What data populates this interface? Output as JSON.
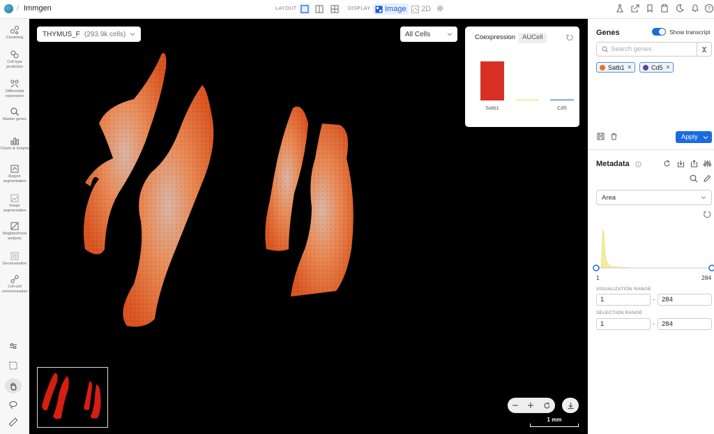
{
  "header": {
    "breadcrumb_sep": "/",
    "app_title": "Immgen",
    "layout_label": "LAYOUT",
    "display_label": "DISPLAY",
    "display_image": "Image",
    "display_2d": "2D"
  },
  "sidebar": {
    "items": [
      {
        "label": "Clustering",
        "icon": "clustering-icon"
      },
      {
        "label": "Cell type prediction",
        "icon": "cell-type-icon"
      },
      {
        "label": "Differential expression",
        "icon": "diff-expr-icon"
      },
      {
        "label": "Marker genes",
        "icon": "marker-genes-icon"
      },
      {
        "label": "Charts & Graphs",
        "icon": "charts-icon"
      },
      {
        "label": "Region segmentation",
        "icon": "region-seg-icon"
      },
      {
        "label": "Image segmentation",
        "icon": "image-seg-icon"
      },
      {
        "label": "Neighborhood analysis",
        "icon": "neighborhood-icon"
      },
      {
        "label": "Deconvolution",
        "icon": "deconvolution-icon"
      },
      {
        "label": "Cell-cell communication",
        "icon": "cell-comm-icon"
      }
    ]
  },
  "viewer": {
    "sample_name": "THYMUS_F",
    "sample_cells": "(293.9k cells)",
    "cell_filter": "All Cells",
    "scale_label": "1 mm"
  },
  "coexpression": {
    "tabs": [
      "Coexpression",
      "AUCell"
    ],
    "active_tab": "Coexpression"
  },
  "chart_data": {
    "type": "bar",
    "categories": [
      "Satb1",
      "",
      "Cd5"
    ],
    "values": [
      1.0,
      0.02,
      0.02
    ],
    "colors": [
      "#d93025",
      "#f0e68c",
      "#5b8dd6"
    ],
    "ylim": [
      0,
      1.2
    ]
  },
  "genes": {
    "title": "Genes",
    "show_transcript_label": "Show transcript",
    "search_placeholder": "Search genes",
    "chips": [
      {
        "label": "Satb1",
        "color": "#e8731a"
      },
      {
        "label": "Cd5",
        "color": "#6b3f8f"
      }
    ],
    "apply_label": "Apply"
  },
  "metadata": {
    "title": "Metadata",
    "selected_field": "Area",
    "hist_min": "1",
    "hist_max": "284",
    "viz_range_label": "VISUALIZATION RANGE",
    "viz_min": "1",
    "viz_max": "284",
    "sel_range_label": "SELECTION RANGE",
    "sel_min": "1",
    "sel_max": "284",
    "range_sep": "-"
  }
}
